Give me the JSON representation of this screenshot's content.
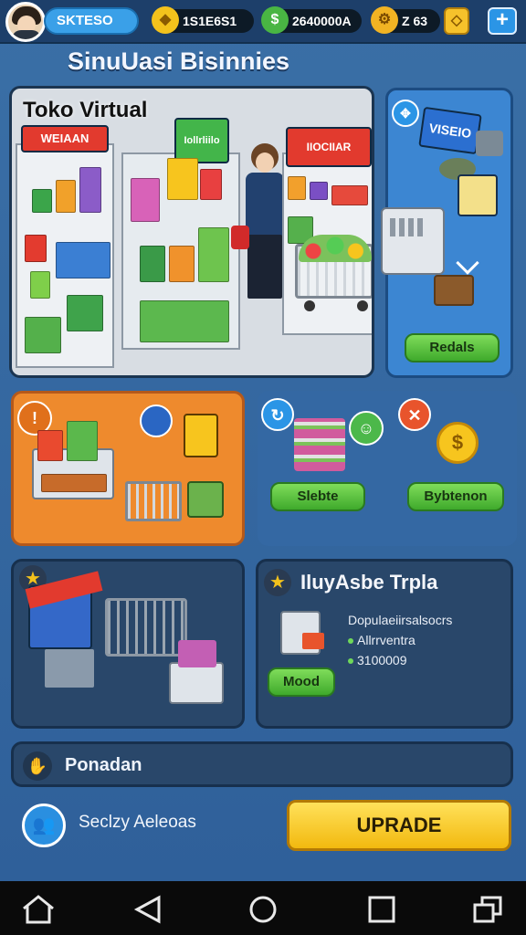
{
  "header": {
    "player_name": "SKTESO",
    "stat_coins": "1S1E6S1",
    "stat_cash": "2640000A",
    "stat_gold": "Z 63"
  },
  "title": "SinuUasi Bisinnies",
  "store_panel": {
    "title": "Toko Virtual",
    "sign_left": "WEIAAN",
    "sign_middle": "Iollrliilo",
    "sign_right": "IIOCIIAR"
  },
  "flow_panel": {
    "sign_top": "VISEIO",
    "button": "Redals"
  },
  "items_panel": {
    "button_left": "Slebte",
    "button_right": "Bybtenon"
  },
  "info_panel": {
    "title": "IluyAsbe Trpla",
    "line1": "Dopulaeiirsalsocrs",
    "line2": "Allrrventra",
    "line3": "3100009",
    "button": "Mood"
  },
  "bar": {
    "label": "Ponadan"
  },
  "bottom": {
    "label": "Seclzy Aeleoas",
    "upgrade": "UPRADE"
  },
  "colors": {
    "accent_blue": "#3aa0e8",
    "green_button": "#4fbf36",
    "upgrade_yellow": "#f7c51e",
    "orange_panel": "#ee8a2d"
  },
  "icons": {
    "coins": "coin-stack-icon",
    "cash": "cash-icon",
    "gold": "gold-icon",
    "gem": "gem-icon",
    "add": "plus-icon",
    "star": "star-icon",
    "hand": "hand-icon",
    "people": "people-icon"
  }
}
